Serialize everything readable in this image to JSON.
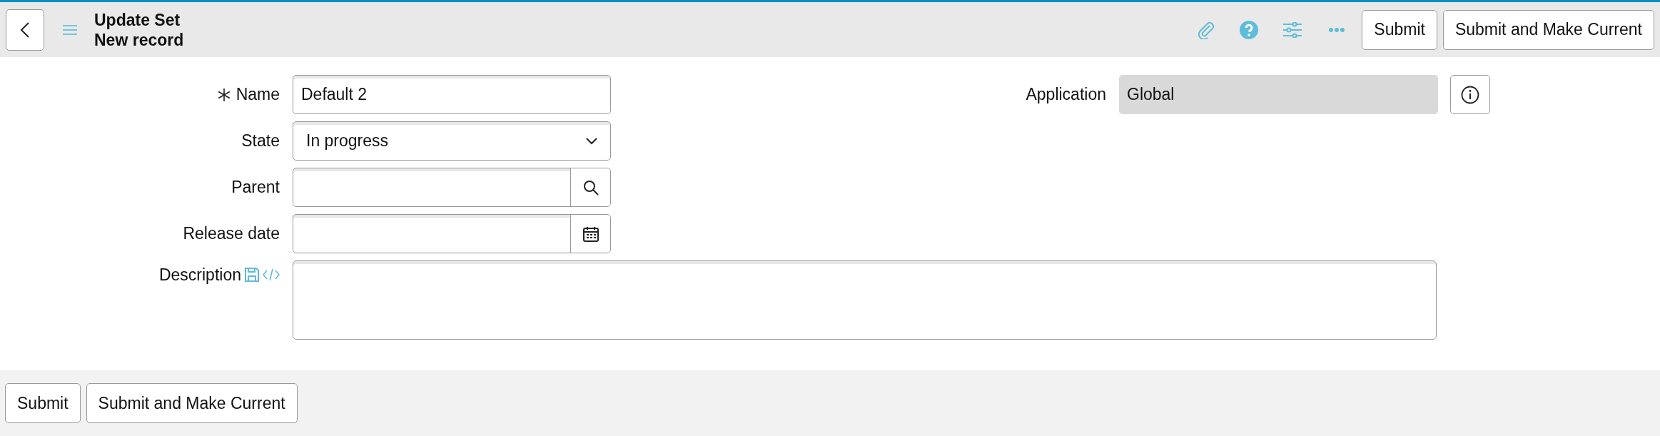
{
  "header": {
    "title": "Update Set",
    "subtitle": "New record",
    "buttons": [
      "Submit",
      "Submit and Make Current"
    ]
  },
  "fields": [
    {
      "label": "Name",
      "kind": "text",
      "required": true,
      "value": "Default 2"
    },
    {
      "label": "State",
      "kind": "select",
      "value": "In progress"
    },
    {
      "label": "Parent",
      "kind": "reference"
    },
    {
      "label": "Release date",
      "kind": "date"
    },
    {
      "label": "Description",
      "kind": "textarea"
    }
  ],
  "application": {
    "label": "Application",
    "value": "Global"
  },
  "footer": {
    "buttons": [
      "Submit",
      "Submit and Make Current"
    ]
  }
}
